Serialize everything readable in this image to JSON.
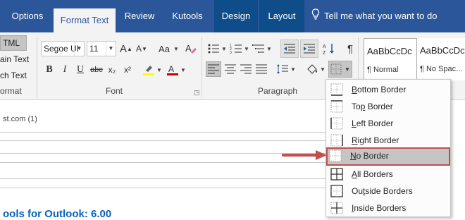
{
  "tabs": [
    {
      "label": "Options",
      "state": "normal"
    },
    {
      "label": "Format Text",
      "state": "active"
    },
    {
      "label": "Review",
      "state": "normal"
    },
    {
      "label": "Kutools",
      "state": "normal"
    },
    {
      "label": "Design",
      "state": "contextual"
    },
    {
      "label": "Layout",
      "state": "contextual"
    }
  ],
  "tell_me": "Tell me what you want to do",
  "format_group": {
    "html_label": "TML",
    "plain_text": "ain Text",
    "rich_text": "ch Text",
    "label": "ormat"
  },
  "font": {
    "name": "Segoe UI",
    "size": "11",
    "grow_icon": "A",
    "shrink_icon": "A",
    "case_label": "Aa",
    "label": "Font",
    "bold": "B",
    "italic": "I",
    "underline": "U",
    "strike": "abc",
    "subscript": "x₂",
    "superscript": "x²",
    "highlight_color": "#ffff00",
    "font_color": "#c00000"
  },
  "paragraph": {
    "label": "Paragraph",
    "pilcrow": "¶"
  },
  "styles": [
    {
      "sample": "AaBbCcDc",
      "name": "¶ Normal"
    },
    {
      "sample": "AaBbCcDc",
      "name": "¶ No Spac..."
    }
  ],
  "document": {
    "email_snippet": "st.com (1)",
    "link_text": "ools for Outlook: 6.00"
  },
  "border_menu": {
    "items": [
      {
        "pre": "",
        "u": "B",
        "post": "ottom Border",
        "icon": "bottom-border-icon"
      },
      {
        "pre": "To",
        "u": "p",
        "post": " Border",
        "icon": "top-border-icon"
      },
      {
        "pre": "",
        "u": "L",
        "post": "eft Border",
        "icon": "left-border-icon"
      },
      {
        "pre": "",
        "u": "R",
        "post": "ight Border",
        "icon": "right-border-icon"
      },
      {
        "pre": "",
        "u": "N",
        "post": "o Border",
        "icon": "no-border-icon",
        "highlighted": true
      },
      {
        "pre": "",
        "u": "A",
        "post": "ll Borders",
        "icon": "all-borders-icon"
      },
      {
        "pre": "Ou",
        "u": "t",
        "post": "side Borders",
        "icon": "outside-borders-icon"
      },
      {
        "pre": "",
        "u": "I",
        "post": "nside Borders",
        "icon": "inside-borders-icon"
      }
    ]
  },
  "colors": {
    "tab_bar": "#2b579a",
    "ribbon": "#f3f3f3",
    "highlight_outline": "#c0504d",
    "arrow": "#c0504d",
    "link": "#0563c1"
  }
}
